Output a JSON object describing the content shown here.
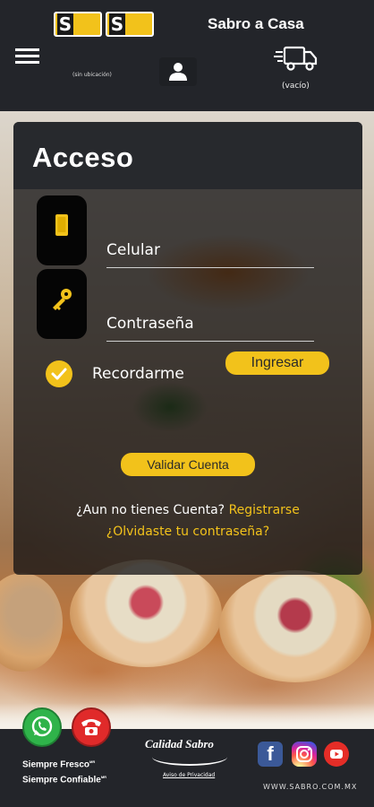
{
  "header": {
    "logos": [
      "Sabro Pollo",
      "Sabro Cerdo"
    ],
    "title": "Sabro a Casa",
    "location": "(sin ubicación)",
    "cart_status": "(vacío)"
  },
  "login": {
    "title": "Acceso",
    "phone_placeholder": "Celular",
    "password_placeholder": "Contraseña",
    "remember_label": "Recordarme",
    "submit_label": "Ingresar",
    "validate_label": "Validar Cuenta",
    "no_account_text": "¿Aun no tienes Cuenta?",
    "register_link": "Registrarse",
    "forgot_link": "¿Olvidaste tu contraseña?"
  },
  "footer": {
    "slogan_1": "Siempre Fresco",
    "slogan_2": "Siempre Confiable",
    "quality_brand": "Calidad Sabro",
    "privacy_link": "Aviso de Privacidad",
    "website": "WWW.SABRO.COM.MX",
    "social": [
      "facebook-icon",
      "instagram-icon",
      "youtube-icon"
    ]
  },
  "colors": {
    "accent": "#f2c21b",
    "header_bg": "#23252a",
    "whatsapp": "#2fb34a",
    "call": "#e02a2a"
  }
}
